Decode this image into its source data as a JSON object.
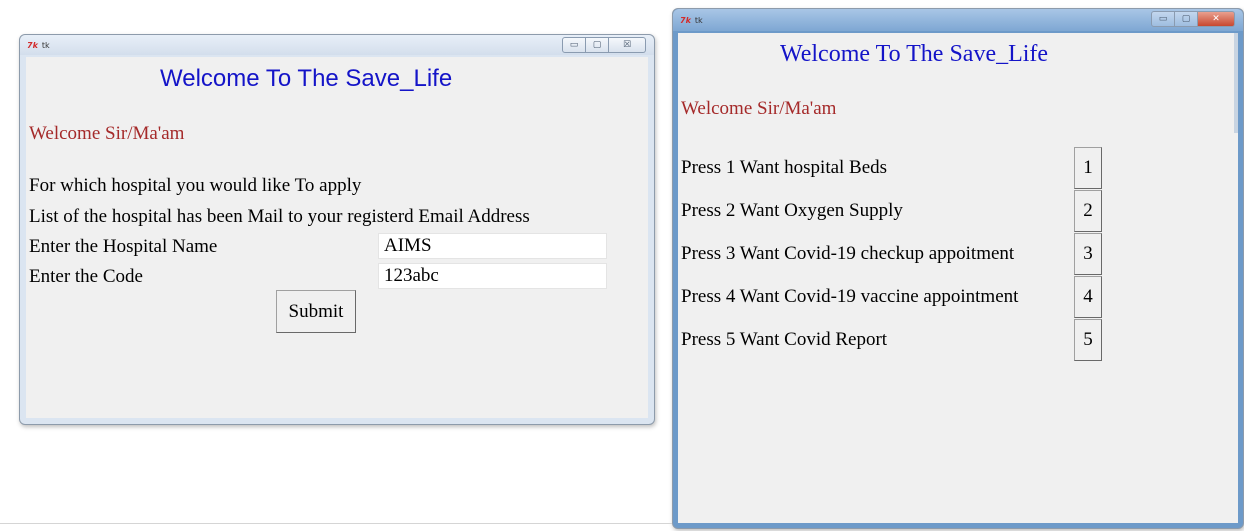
{
  "window_left": {
    "logo": "7k",
    "title": "tk",
    "controls": {
      "minimize": "▭",
      "maximize": "▢",
      "close": "☒"
    },
    "heading": "Welcome To The Save_Life",
    "welcome": "Welcome Sir/Ma'am",
    "prompt_line1": "For which hospital you would like To apply",
    "prompt_line2": "List of the hospital has been Mail to your registerd Email Address",
    "hospital_label": "Enter the Hospital Name",
    "hospital_value": "AIMS",
    "code_label": "Enter the Code",
    "code_value": "123abc",
    "submit_label": "Submit"
  },
  "window_right": {
    "logo": "7k",
    "title": "tk",
    "controls": {
      "minimize": "▭",
      "maximize": "▢",
      "close": "✕"
    },
    "heading": "Welcome To The Save_Life",
    "welcome": "Welcome Sir/Ma'am",
    "options": [
      {
        "label": "Press 1 Want hospital Beds",
        "button": "1"
      },
      {
        "label": "Press 2 Want Oxygen Supply",
        "button": "2"
      },
      {
        "label": "Press 3 Want Covid-19 checkup appoitment",
        "button": "3"
      },
      {
        "label": "Press 4 Want Covid-19 vaccine appointment",
        "button": "4"
      },
      {
        "label": "Press 5 Want Covid Report",
        "button": "5"
      }
    ]
  }
}
